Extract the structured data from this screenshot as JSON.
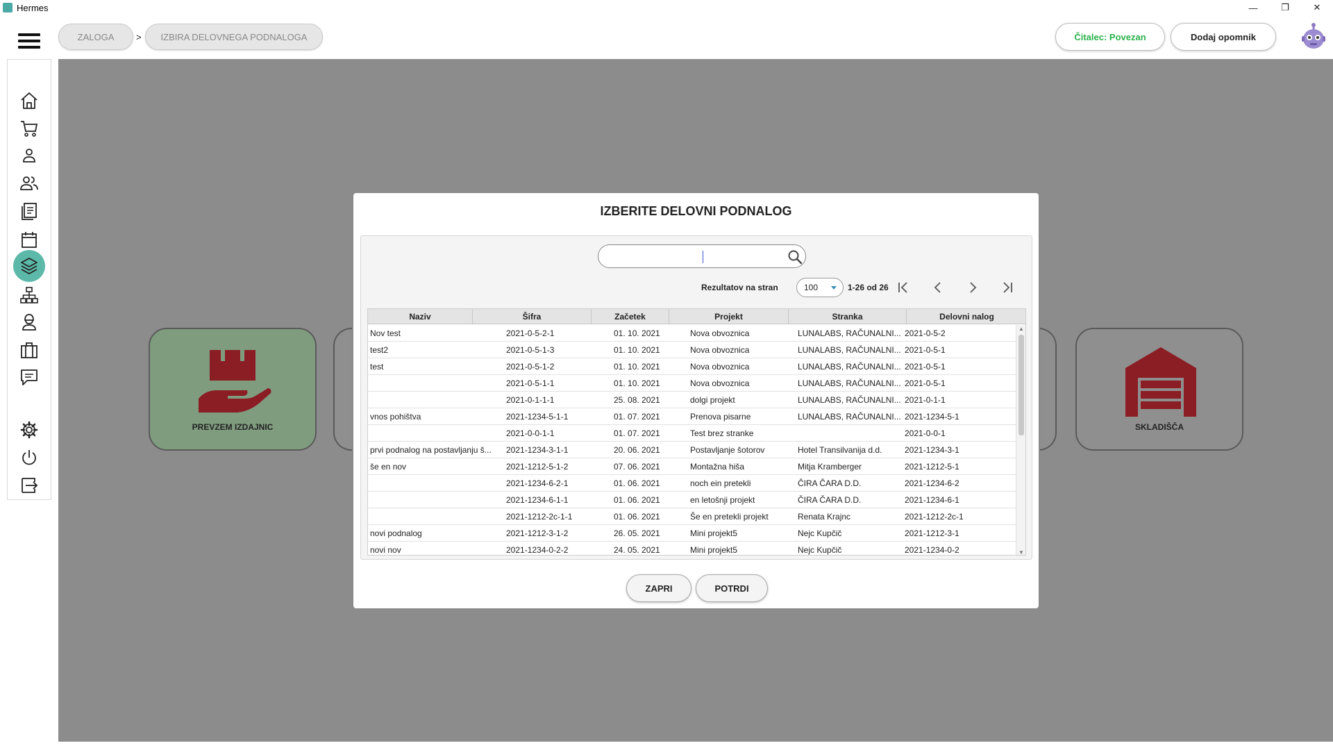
{
  "window": {
    "title": "Hermes",
    "controls": [
      "—",
      "❐",
      "✕"
    ]
  },
  "header": {
    "breadcrumb": [
      "ZALOGA",
      "IZBIRA DELOVNEGA PODNALOGA"
    ],
    "separator": ">",
    "reader_status": "Čitalec: Povezan",
    "add_reminder": "Dodaj opomnik",
    "colors": {
      "reader_status_text": "#2ab24b"
    }
  },
  "sidebar": {
    "items": [
      {
        "icon": "home-icon"
      },
      {
        "icon": "cart-icon"
      },
      {
        "icon": "user-icon"
      },
      {
        "icon": "users-icon"
      },
      {
        "icon": "documents-icon"
      },
      {
        "icon": "calendar-icon"
      },
      {
        "icon": "layers-icon",
        "active": true
      },
      {
        "icon": "hierarchy-icon"
      },
      {
        "icon": "worker-icon"
      },
      {
        "icon": "briefcase-icon"
      },
      {
        "icon": "chat-icon"
      },
      {
        "icon": "settings-icon"
      },
      {
        "icon": "power-icon"
      },
      {
        "icon": "logout-icon"
      }
    ],
    "colors": {
      "active_bg": "#5cb8a8"
    }
  },
  "tiles": [
    {
      "label": "PREVZEM IZDAJNIC",
      "icon": "hand-box-icon"
    },
    {
      "label": "SKLADIŠČA",
      "icon": "warehouse-icon"
    }
  ],
  "modal": {
    "title": "IZBERITE DELOVNI PODNALOG",
    "search": {
      "value": "",
      "placeholder": ""
    },
    "pagination": {
      "per_page_label": "Rezultatov na stran",
      "per_page": "100",
      "range": "1-26 od 26"
    },
    "table": {
      "columns": [
        "Naziv",
        "Šifra",
        "Začetek",
        "Projekt",
        "Stranka",
        "Delovni nalog"
      ],
      "rows": [
        [
          "Nov test",
          "2021-0-5-2-1",
          "01. 10. 2021",
          "Nova obvoznica",
          "LUNALABS, RAČUNALNI...",
          "2021-0-5-2"
        ],
        [
          "test2",
          "2021-0-5-1-3",
          "01. 10. 2021",
          "Nova obvoznica",
          "LUNALABS, RAČUNALNI...",
          "2021-0-5-1"
        ],
        [
          "test",
          "2021-0-5-1-2",
          "01. 10. 2021",
          "Nova obvoznica",
          "LUNALABS, RAČUNALNI...",
          "2021-0-5-1"
        ],
        [
          "",
          "2021-0-5-1-1",
          "01. 10. 2021",
          "Nova obvoznica",
          "LUNALABS, RAČUNALNI...",
          "2021-0-5-1"
        ],
        [
          "",
          "2021-0-1-1-1",
          "25. 08. 2021",
          "dolgi projekt",
          "LUNALABS, RAČUNALNI...",
          "2021-0-1-1"
        ],
        [
          "vnos pohištva",
          "2021-1234-5-1-1",
          "01. 07. 2021",
          "Prenova pisarne",
          "LUNALABS, RAČUNALNI...",
          "2021-1234-5-1"
        ],
        [
          "",
          "2021-0-0-1-1",
          "01. 07. 2021",
          "Test brez stranke",
          "",
          "2021-0-0-1"
        ],
        [
          "prvi podnalog na postavljanju š...",
          "2021-1234-3-1-1",
          "20. 06. 2021",
          "Postavljanje šotorov",
          "Hotel Transilvanija d.d.",
          "2021-1234-3-1"
        ],
        [
          "še en nov",
          "2021-1212-5-1-2",
          "07. 06. 2021",
          "Montažna hiša",
          "Mitja Kramberger",
          "2021-1212-5-1"
        ],
        [
          "",
          "2021-1234-6-2-1",
          "01. 06. 2021",
          "noch ein pretekli",
          "ČIRA ČARA D.D.",
          "2021-1234-6-2"
        ],
        [
          "",
          "2021-1234-6-1-1",
          "01. 06. 2021",
          "en letošnji projekt",
          "ČIRA ČARA D.D.",
          "2021-1234-6-1"
        ],
        [
          "",
          "2021-1212-2c-1-1",
          "01. 06. 2021",
          "Še en pretekli projekt",
          "Renata Krajnc",
          "2021-1212-2c-1"
        ],
        [
          "novi podnalog",
          "2021-1212-3-1-2",
          "26. 05. 2021",
          "Mini projekt5",
          "Nejc Kupčič",
          "2021-1212-3-1"
        ],
        [
          "novi nov",
          "2021-1234-0-2-2",
          "24. 05. 2021",
          "Mini projekt5",
          "Nejc Kupčič",
          "2021-1234-0-2"
        ]
      ]
    },
    "buttons": {
      "close": "ZAPRI",
      "confirm": "POTRDI"
    }
  },
  "colors": {
    "overlay_bg": "#8c8c8c",
    "brand_red": "#8b1d24",
    "tile_green": "#7f9c7f"
  }
}
